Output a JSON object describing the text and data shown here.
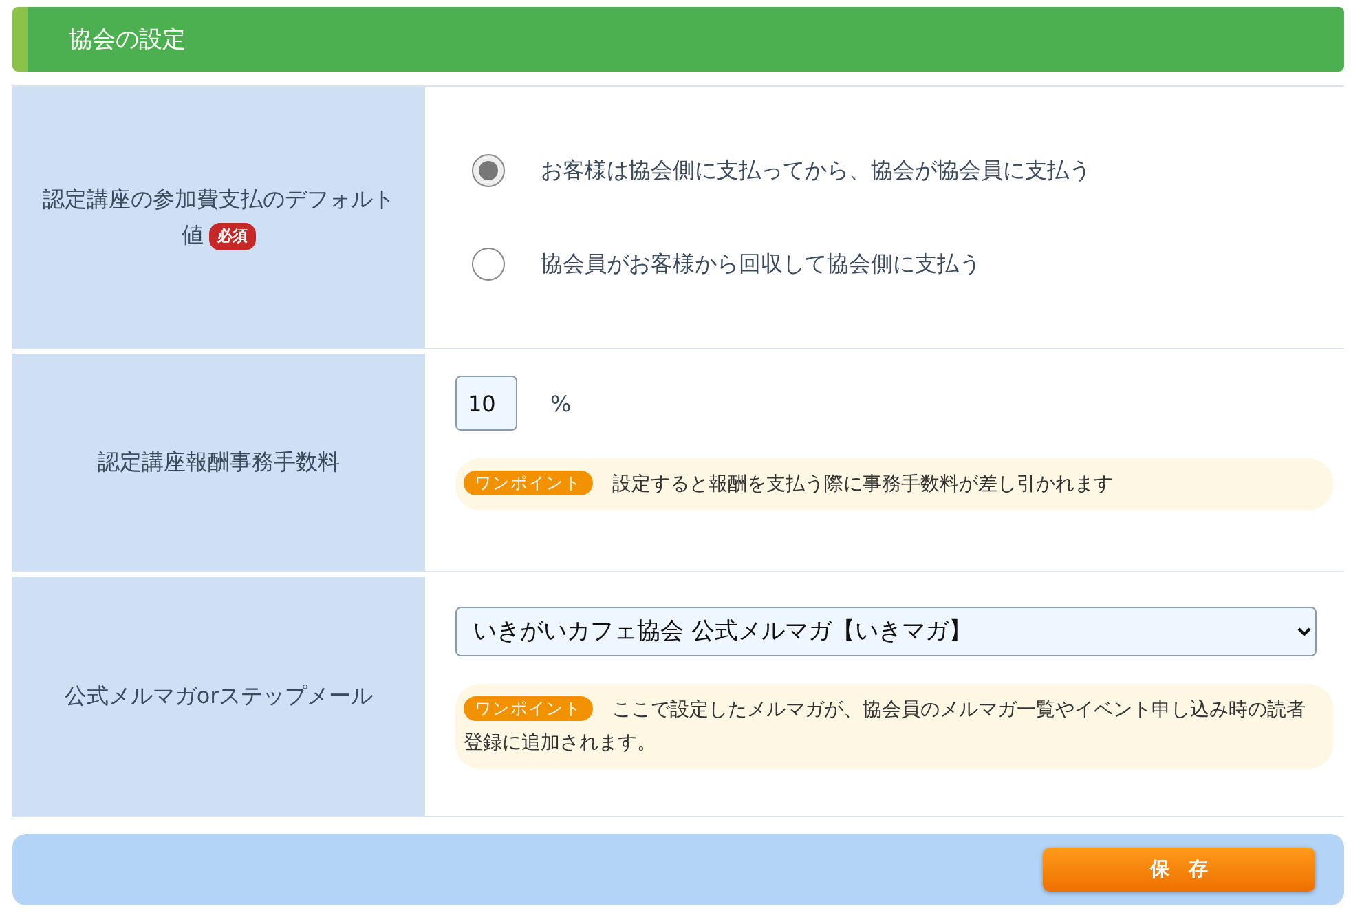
{
  "header": {
    "title": "協会の設定"
  },
  "rows": [
    {
      "kind": "radio",
      "label": "認定講座の参加費支払のデフォルト値",
      "required_badge": "必須",
      "options": [
        {
          "label": "お客様は協会側に支払ってから、協会が協会員に支払う",
          "selected": true
        },
        {
          "label": "協会員がお客様から回収して協会側に支払う",
          "selected": false
        }
      ]
    },
    {
      "kind": "number",
      "label": "認定講座報酬事務手数料",
      "value": "10",
      "unit": "%",
      "tip_badge": "ワンポイント",
      "tip": "設定すると報酬を支払う際に事務手数料が差し引かれます"
    },
    {
      "kind": "select",
      "label": "公式メルマガorステップメール",
      "value": "いきがいカフェ協会 公式メルマガ【いきマガ】",
      "tip_badge": "ワンポイント",
      "tip": "ここで設定したメルマガが、協会員のメルマガ一覧やイベント申し込み時の読者登録に追加されます。"
    }
  ],
  "footer": {
    "save_button": "保　存"
  }
}
